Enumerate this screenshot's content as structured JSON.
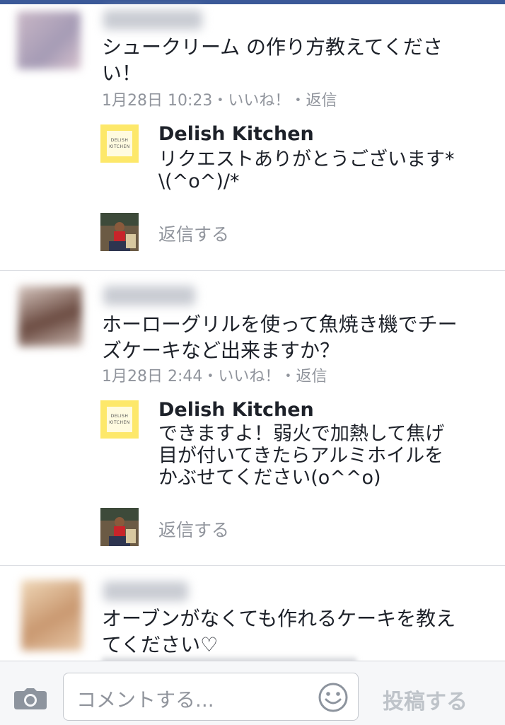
{
  "threads": [
    {
      "comment": "シュークリーム の作り方教えてくださ\nい！",
      "time": "1月28日 10:23",
      "like": "いいね！",
      "reply": "返信",
      "response": {
        "page_name": "Delish Kitchen",
        "text": "リクエストありがとうございます*\n\\(^o^)/*"
      },
      "reply_prompt": "返信する"
    },
    {
      "comment": "ホーローグリルを使って魚焼き機でチー\nズケーキなど出来ますか？",
      "time": "1月28日 2:44",
      "like": "いいね！",
      "reply": "返信",
      "response": {
        "page_name": "Delish Kitchen",
        "text": "できますよ！弱火で加熱して焦げ\n目が付いてきたらアルミホイルを\nかぶせてください(o^^o)"
      },
      "reply_prompt": "返信する"
    },
    {
      "comment": "オーブンがなくても作れるケーキを教え\nてください♡"
    }
  ],
  "logo_text": {
    "line1": "DELISH",
    "line2": "KITCHEN"
  },
  "meta_separator": "・",
  "composer": {
    "placeholder": "コメントする...",
    "post_label": "投稿する"
  },
  "colors": {
    "accent_bar": "#3b5998",
    "meta_gray": "#90949c",
    "logo_yellow": "#fde86a",
    "post_disabled": "#bec3c9"
  },
  "icons": [
    "camera-icon",
    "smiley-icon"
  ]
}
